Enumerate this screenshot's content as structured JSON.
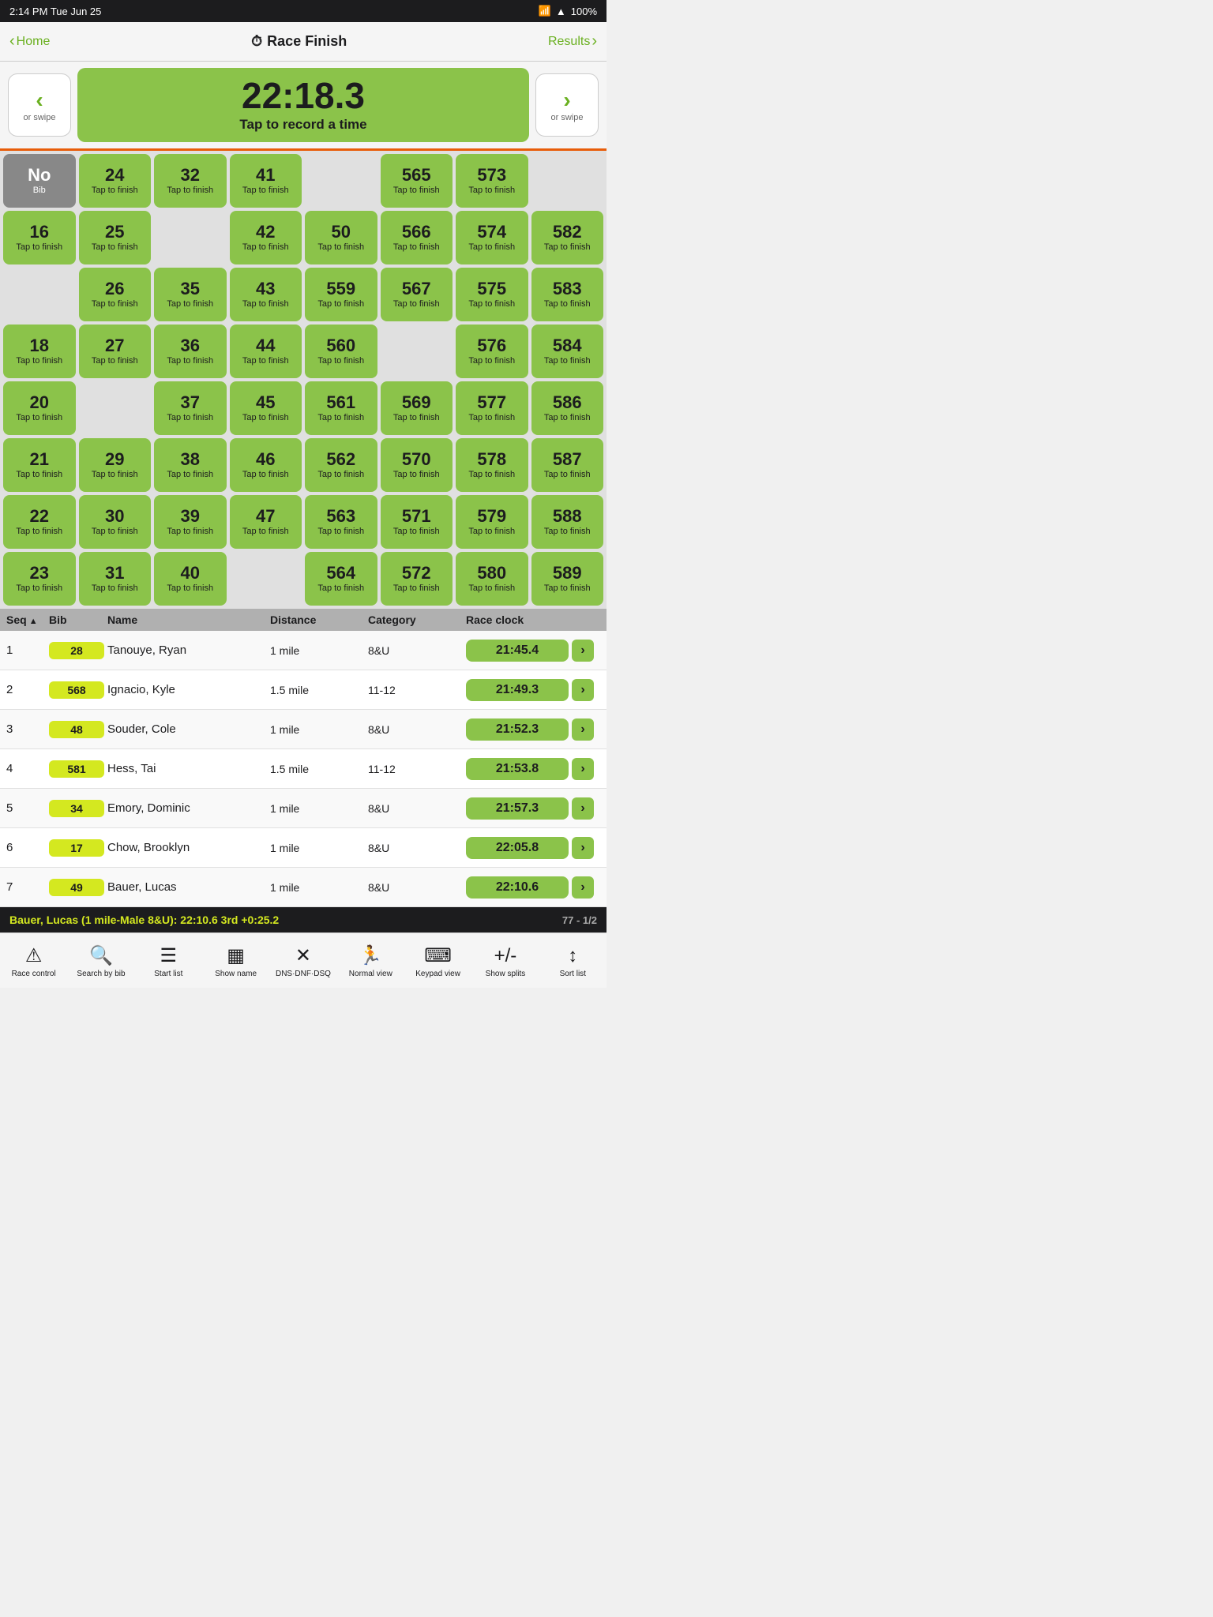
{
  "statusBar": {
    "time": "2:14 PM",
    "date": "Tue Jun 25",
    "battery": "100%"
  },
  "navBar": {
    "homeLabel": "Home",
    "title": "Race Finish",
    "resultsLabel": "Results"
  },
  "timer": {
    "time": "22:18.3",
    "label": "Tap to record a time",
    "leftSwipe": "or swipe",
    "rightSwipe": "or swipe"
  },
  "bibGrid": {
    "tapLabel": "Tap to finish",
    "noBibLabel": "No Bib",
    "tiles": [
      {
        "bib": "No Bib",
        "type": "no-bib"
      },
      {
        "bib": "24"
      },
      {
        "bib": "32"
      },
      {
        "bib": "41"
      },
      {
        "bib": "",
        "type": "empty"
      },
      {
        "bib": "565"
      },
      {
        "bib": "573"
      },
      {
        "bib": "",
        "type": "empty"
      },
      {
        "bib": "16"
      },
      {
        "bib": "25"
      },
      {
        "bib": "",
        "type": "empty"
      },
      {
        "bib": "42"
      },
      {
        "bib": "50"
      },
      {
        "bib": "566"
      },
      {
        "bib": "574"
      },
      {
        "bib": "582"
      },
      {
        "bib": "",
        "type": "empty"
      },
      {
        "bib": "26"
      },
      {
        "bib": "35"
      },
      {
        "bib": "43"
      },
      {
        "bib": "559"
      },
      {
        "bib": "567"
      },
      {
        "bib": "575"
      },
      {
        "bib": "583"
      },
      {
        "bib": "18"
      },
      {
        "bib": "27"
      },
      {
        "bib": "36"
      },
      {
        "bib": "44"
      },
      {
        "bib": "560"
      },
      {
        "bib": "",
        "type": "empty"
      },
      {
        "bib": "576"
      },
      {
        "bib": "584"
      },
      {
        "bib": "20"
      },
      {
        "bib": "",
        "type": "empty"
      },
      {
        "bib": "37"
      },
      {
        "bib": "45"
      },
      {
        "bib": "561"
      },
      {
        "bib": "569"
      },
      {
        "bib": "577"
      },
      {
        "bib": "586"
      },
      {
        "bib": "21"
      },
      {
        "bib": "29"
      },
      {
        "bib": "38"
      },
      {
        "bib": "46"
      },
      {
        "bib": "562"
      },
      {
        "bib": "570"
      },
      {
        "bib": "578"
      },
      {
        "bib": "587"
      },
      {
        "bib": "22"
      },
      {
        "bib": "30"
      },
      {
        "bib": "39"
      },
      {
        "bib": "47"
      },
      {
        "bib": "563"
      },
      {
        "bib": "571"
      },
      {
        "bib": "579"
      },
      {
        "bib": "588"
      },
      {
        "bib": "23"
      },
      {
        "bib": "31"
      },
      {
        "bib": "40"
      },
      {
        "bib": "",
        "type": "empty"
      },
      {
        "bib": "564"
      },
      {
        "bib": "572"
      },
      {
        "bib": "580"
      },
      {
        "bib": "589"
      }
    ]
  },
  "tableHeaders": {
    "seq": "Seq",
    "bib": "Bib",
    "name": "Name",
    "distance": "Distance",
    "category": "Category",
    "raceClock": "Race clock"
  },
  "results": [
    {
      "seq": 1,
      "bib": 28,
      "name": "Tanouye, Ryan",
      "distance": "1 mile",
      "category": "8&U",
      "time": "21:45.4"
    },
    {
      "seq": 2,
      "bib": 568,
      "name": "Ignacio, Kyle",
      "distance": "1.5 mile",
      "category": "11-12",
      "time": "21:49.3"
    },
    {
      "seq": 3,
      "bib": 48,
      "name": "Souder, Cole",
      "distance": "1 mile",
      "category": "8&U",
      "time": "21:52.3"
    },
    {
      "seq": 4,
      "bib": 581,
      "name": "Hess, Tai",
      "distance": "1.5 mile",
      "category": "11-12",
      "time": "21:53.8"
    },
    {
      "seq": 5,
      "bib": 34,
      "name": "Emory, Dominic",
      "distance": "1 mile",
      "category": "8&U",
      "time": "21:57.3"
    },
    {
      "seq": 6,
      "bib": 17,
      "name": "Chow, Brooklyn",
      "distance": "1 mile",
      "category": "8&U",
      "time": "22:05.8"
    },
    {
      "seq": 7,
      "bib": 49,
      "name": "Bauer, Lucas",
      "distance": "1 mile",
      "category": "8&U",
      "time": "22:10.6"
    }
  ],
  "statusBottom": {
    "text": "Bauer, Lucas (1 mile-Male 8&U): 22:10.6 3rd +0:25.2",
    "pageInfo": "77 - 1/2"
  },
  "toolbar": [
    {
      "icon": "⚠",
      "label": "Race control",
      "name": "race-control"
    },
    {
      "icon": "🔍",
      "label": "Search by bib",
      "name": "search-by-bib"
    },
    {
      "icon": "☰",
      "label": "Start list",
      "name": "start-list"
    },
    {
      "icon": "▦",
      "label": "Show name",
      "name": "show-name"
    },
    {
      "icon": "✕",
      "label": "DNS·DNF·DSQ",
      "name": "dns-dnf-dsq"
    },
    {
      "icon": "🏃",
      "label": "Normal view",
      "name": "normal-view"
    },
    {
      "icon": "⌨",
      "label": "Keypad view",
      "name": "keypad-view"
    },
    {
      "icon": "+/-",
      "label": "Show splits",
      "name": "show-splits"
    },
    {
      "icon": "↕",
      "label": "Sort list",
      "name": "sort-list"
    }
  ]
}
